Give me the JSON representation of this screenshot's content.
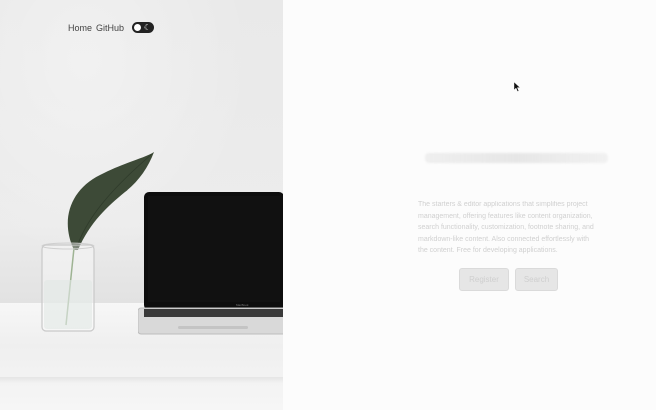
{
  "nav": {
    "home_label": "Home",
    "github_label": "GitHub",
    "theme_toggle_icon": "moon-icon"
  },
  "hero": {
    "description": "The starters & editor applications that simplifies project management, offering features like content organization, search functionality, customization, footnote sharing, and markdown-like content. Also connected effortlessly with the content. Free for developing applications."
  },
  "buttons": {
    "primary_label": "Register",
    "secondary_label": "Search"
  },
  "colors": {
    "toggle_bg": "#222222",
    "button_bg": "#e6e6e6"
  }
}
